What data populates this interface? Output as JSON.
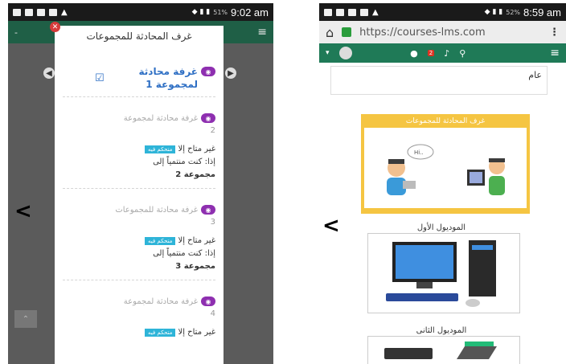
{
  "phone1": {
    "status": {
      "battery": "51%",
      "time": "9:02 am"
    },
    "dialog": {
      "title": "غرف المحادثة للمجموعات",
      "close_glyph": "✕",
      "items": [
        {
          "label": "غرفة محادثة",
          "label2": "لمجموعة 1",
          "active": true
        },
        {
          "label": "غرفة محادثة لمجموعة",
          "number": "2",
          "badge": "متحكم فيه",
          "unavailable": "غير متاح إلا",
          "condition": "إذا: كنت منتمياً إلى",
          "group": "مجموعة 2"
        },
        {
          "label": "غرفة محادثة للمجموعات",
          "number": "3",
          "badge": "متحكم فيه",
          "unavailable": "غير متاح إلا",
          "condition": "إذا: كنت منتمياً إلى",
          "group": "مجموعة 3"
        },
        {
          "label": "غرفة محادثة لمجموعة",
          "number": "4",
          "badge": "متحكم فيه",
          "unavailable": "غير متاح إلا"
        }
      ]
    }
  },
  "phone2": {
    "status": {
      "battery": "52%",
      "time": "8:59 am"
    },
    "url": "https://courses-lms.com",
    "notif_count": "2",
    "general": "عام",
    "tile_title": "غرف المحادثة للمجموعات",
    "mod1": "الموديول الأول",
    "mod2": "الموديول الثانى"
  },
  "icons": {
    "back": "<",
    "home": "⌂",
    "menu": "≡",
    "more": "⋮",
    "search": "🔍",
    "bell": "🔔",
    "chat": "💬"
  }
}
